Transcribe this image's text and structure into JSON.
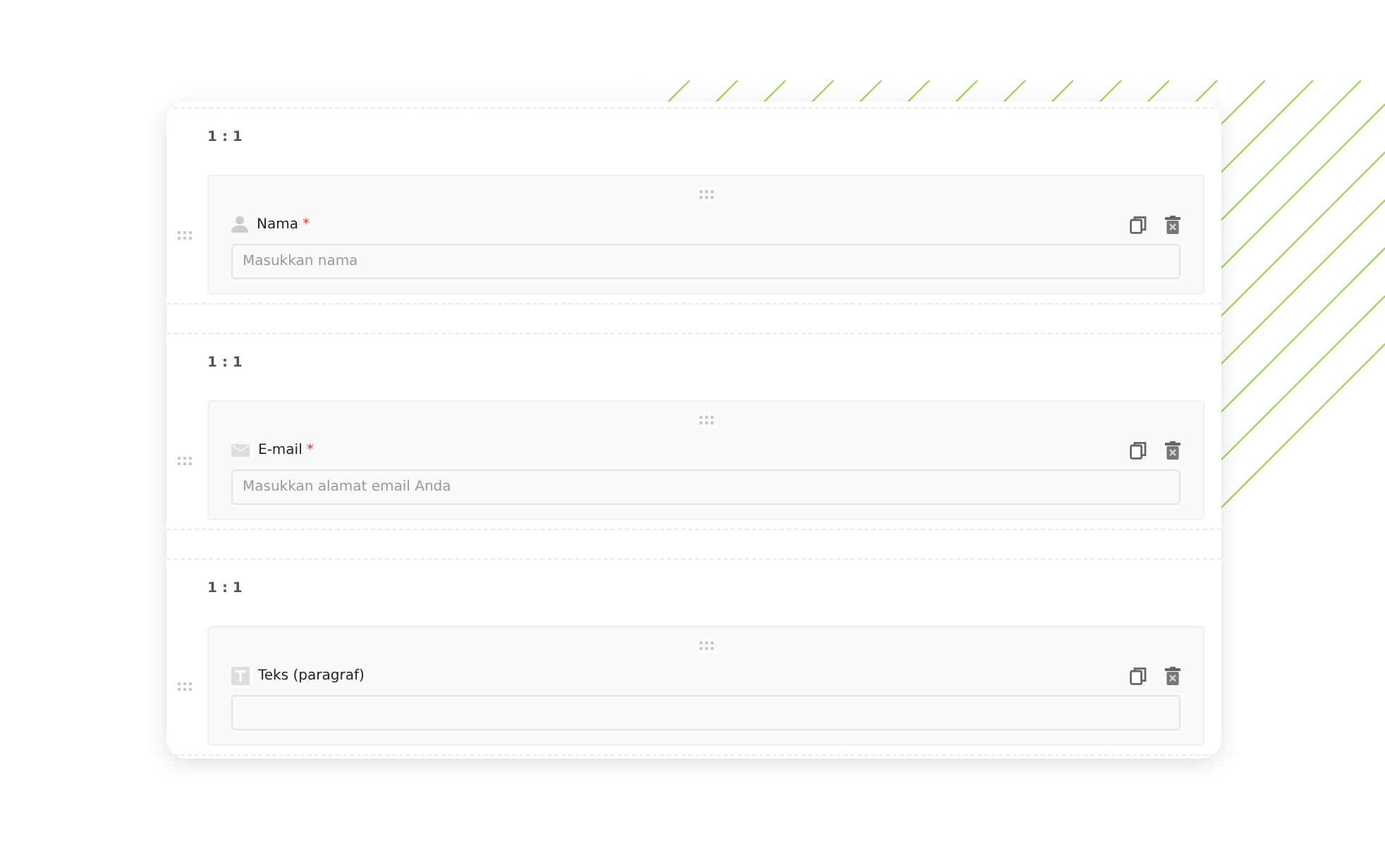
{
  "rows": [
    {
      "ratio": "1 : 1",
      "field": {
        "kind": "person",
        "label": "Nama",
        "required_mark": "*",
        "placeholder": "Masukkan nama"
      }
    },
    {
      "ratio": "1 : 1",
      "field": {
        "kind": "email",
        "label": "E-mail",
        "required_mark": "*",
        "placeholder": "Masukkan alamat email Anda"
      }
    },
    {
      "ratio": "1 : 1",
      "field": {
        "kind": "text",
        "label": "Teks (paragraf)"
      }
    }
  ]
}
